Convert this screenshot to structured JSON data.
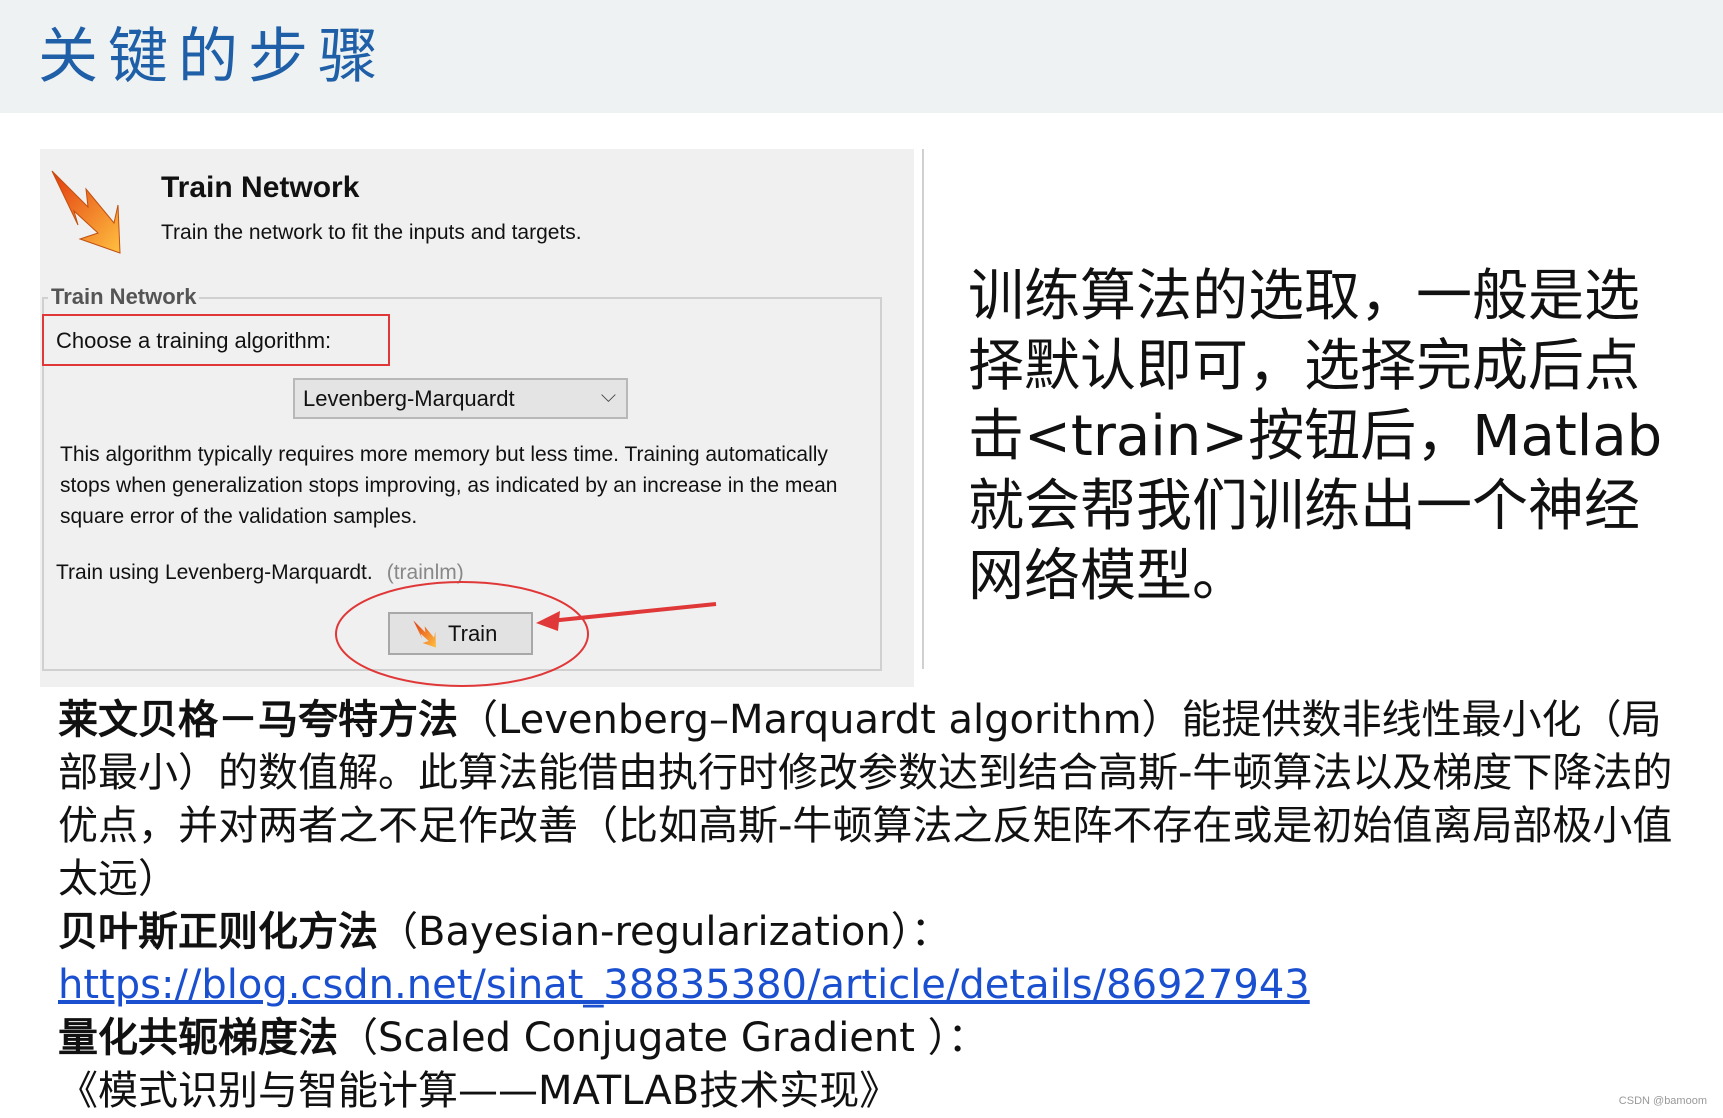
{
  "slide": {
    "title": "关键的步骤"
  },
  "dialog": {
    "title": "Train Network",
    "subtitle": "Train the network to fit the inputs and targets.",
    "group_label": "Train Network",
    "choose_label": "Choose a training algorithm:",
    "algorithm": "Levenberg-Marquardt",
    "description": "This algorithm typically requires more memory but less time. Training automatically stops when generalization stops improving, as indicated by an increase in the mean square error of the validation samples.",
    "train_using": "Train using Levenberg-Marquardt.",
    "train_code": "(trainlm)",
    "train_button": "Train",
    "icon": "lightning-arrow-icon"
  },
  "right_text": "训练算法的选取，一般是选择默认即可，选择完成后点击<train>按钮后，Matlab就会帮我们训练出一个神经网络模型。",
  "body": {
    "lm_title": "莱文贝格－马夸特方法",
    "lm_text": "（Levenberg–Marquardt algorithm）能提供数非线性最小化（局部最小）的数值解。此算法能借由执行时修改参数达到结合高斯-牛顿算法以及梯度下降法的优点，并对两者之不足作改善（比如高斯-牛顿算法之反矩阵不存在或是初始值离局部极小值太远）",
    "br_title": "贝叶斯正则化方法",
    "br_text": "（Bayesian-regularization）：",
    "br_link": "https://blog.csdn.net/sinat_38835380/article/details/86927943",
    "scg_title": "量化共轭梯度法",
    "scg_text": "（Scaled Conjugate Gradient ）：",
    "book": "《模式识别与智能计算——MATLAB技术实现》"
  },
  "watermark": "CSDN @bamoom",
  "colors": {
    "title": "#1f5fa8",
    "annotation": "#e03838",
    "link": "#1a4fd0"
  }
}
